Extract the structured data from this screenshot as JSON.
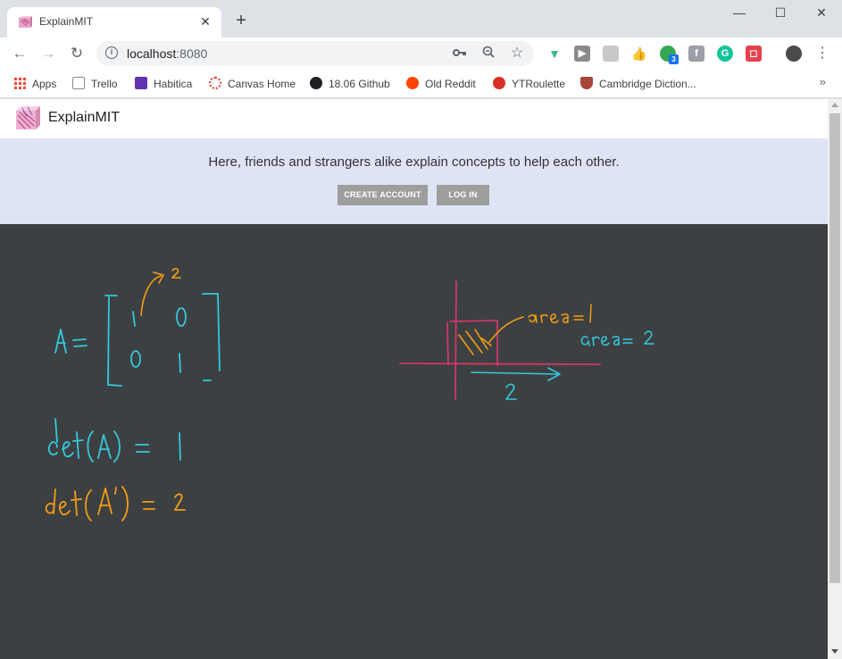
{
  "browser": {
    "tab_title": "ExplainMIT",
    "tab_close": "✕",
    "new_tab": "+",
    "window_controls": {
      "minimize": "—",
      "maximize": "☐",
      "close": "✕"
    },
    "url_host": "localhost",
    "url_port": ":8080",
    "bookmarks": [
      {
        "label": "Apps",
        "icon": "apps-grid-icon",
        "color": "#4285f4"
      },
      {
        "label": "Trello",
        "icon": "trello-icon",
        "color": "#8a8a8a"
      },
      {
        "label": "Habitica",
        "icon": "habitica-icon",
        "color": "#6133b4"
      },
      {
        "label": "Canvas Home",
        "icon": "canvas-icon",
        "color": "#e33d2f"
      },
      {
        "label": "18.06 Github",
        "icon": "github-icon",
        "color": "#202124"
      },
      {
        "label": "Old Reddit",
        "icon": "reddit-icon",
        "color": "#ff4500"
      },
      {
        "label": "YTRoulette",
        "icon": "ytroulette-icon",
        "color": "#d93025"
      },
      {
        "label": "Cambridge Diction...",
        "icon": "cambridge-icon",
        "color": "#a8453a"
      }
    ],
    "more_bookmarks": "»",
    "extension_badge": "3"
  },
  "app": {
    "title": "ExplainMIT",
    "tagline": "Here, friends and strangers alike explain concepts to help each other.",
    "create_account_label": "CREATE ACCOUNT",
    "login_label": "LOG IN"
  },
  "whiteboard": {
    "background": "#3d4042",
    "colors": {
      "cyan": "#33c9dc",
      "orange": "#f39c12",
      "pink": "#e0366a"
    },
    "matrix_label": "A=",
    "matrix_entries": [
      "1",
      "0",
      "0",
      "1"
    ],
    "annotation_superscript": "2",
    "det_a": "det(A) = 1",
    "det_a_prime": "det(A') = 2",
    "area_orange": "area = 1",
    "area_cyan": "area = 2",
    "axis_label_two": "2"
  }
}
